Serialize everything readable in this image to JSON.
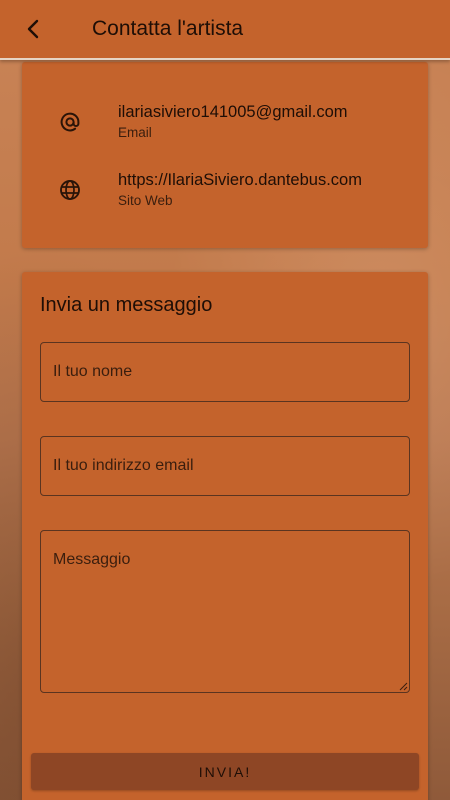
{
  "appbar": {
    "title": "Contatta l'artista",
    "back_icon": "chevron-left-icon"
  },
  "contact": {
    "items": [
      {
        "icon": "at-sign-icon",
        "value": "ilariasiviero141005@gmail.com",
        "label": "Email"
      },
      {
        "icon": "globe-icon",
        "value": "https://IlariaSiviero.dantebus.com",
        "label": "Sito Web"
      }
    ]
  },
  "form": {
    "title": "Invia un messaggio",
    "name_placeholder": "Il tuo nome",
    "email_placeholder": "Il tuo indirizzo email",
    "message_placeholder": "Messaggio",
    "submit_label": "INVIA!"
  },
  "colors": {
    "primary": "#c4632c",
    "button": "#8e4625",
    "text": "#1e0e06"
  }
}
